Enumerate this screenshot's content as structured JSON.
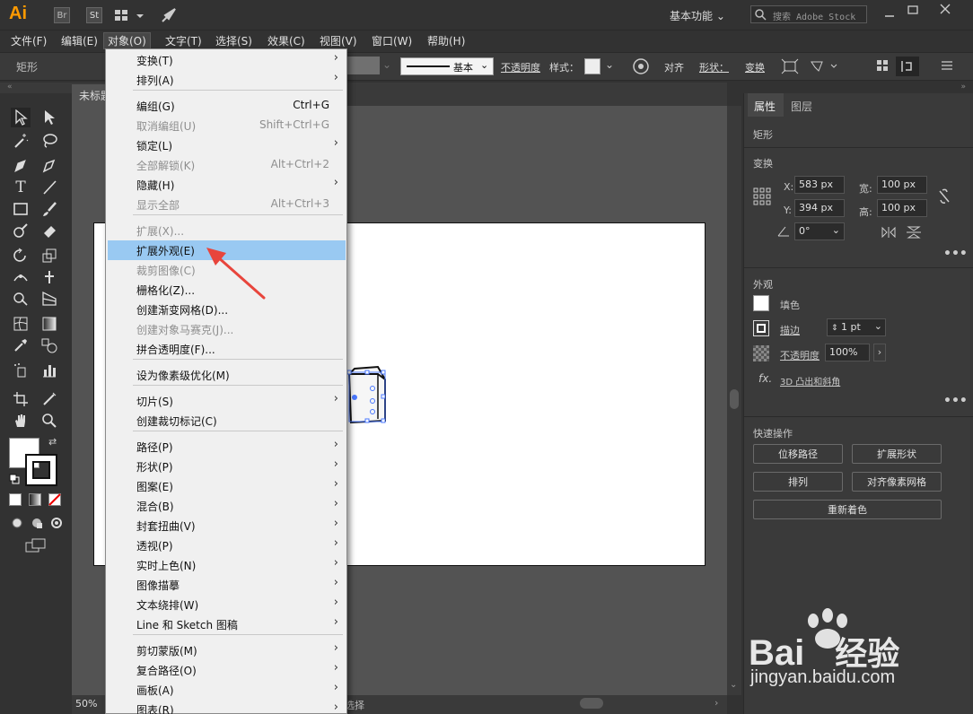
{
  "app": {
    "logo": "Ai",
    "br": "Br",
    "st": "St",
    "workspace": "基本功能",
    "search_placeholder": "搜索 Adobe Stock"
  },
  "menubar": [
    "文件(F)",
    "编辑(E)",
    "对象(O)",
    "文字(T)",
    "选择(S)",
    "效果(C)",
    "视图(V)",
    "窗口(W)",
    "帮助(H)"
  ],
  "control": {
    "shape_label": "矩形",
    "stroke_style": "基本",
    "opacity_label": "不透明度",
    "style_label": "样式：",
    "align": "对齐",
    "shape": "形状：",
    "transform": "变换"
  },
  "document": {
    "tab": "未标题",
    "zoom": "50%",
    "status": "选择"
  },
  "object_menu": {
    "items": [
      {
        "label": "变换(T)",
        "shortcut": "",
        "submenu": true,
        "disabled": false
      },
      {
        "label": "排列(A)",
        "shortcut": "",
        "submenu": true,
        "disabled": false
      },
      {
        "label": "编组(G)",
        "shortcut": "Ctrl+G",
        "submenu": false,
        "disabled": false
      },
      {
        "label": "取消编组(U)",
        "shortcut": "Shift+Ctrl+G",
        "submenu": false,
        "disabled": true
      },
      {
        "label": "锁定(L)",
        "shortcut": "",
        "submenu": true,
        "disabled": false
      },
      {
        "label": "全部解锁(K)",
        "shortcut": "Alt+Ctrl+2",
        "submenu": false,
        "disabled": true
      },
      {
        "label": "隐藏(H)",
        "shortcut": "",
        "submenu": true,
        "disabled": false
      },
      {
        "label": "显示全部",
        "shortcut": "Alt+Ctrl+3",
        "submenu": false,
        "disabled": true
      },
      {
        "label": "扩展(X)...",
        "shortcut": "",
        "submenu": false,
        "disabled": true
      },
      {
        "label": "扩展外观(E)",
        "shortcut": "",
        "submenu": false,
        "disabled": false,
        "highlighted": true
      },
      {
        "label": "裁剪图像(C)",
        "shortcut": "",
        "submenu": false,
        "disabled": true
      },
      {
        "label": "栅格化(Z)...",
        "shortcut": "",
        "submenu": false,
        "disabled": false
      },
      {
        "label": "创建渐变网格(D)...",
        "shortcut": "",
        "submenu": false,
        "disabled": false
      },
      {
        "label": "创建对象马赛克(J)...",
        "shortcut": "",
        "submenu": false,
        "disabled": true
      },
      {
        "label": "拼合透明度(F)...",
        "shortcut": "",
        "submenu": false,
        "disabled": false
      },
      {
        "label": "设为像素级优化(M)",
        "shortcut": "",
        "submenu": false,
        "disabled": false
      },
      {
        "label": "切片(S)",
        "shortcut": "",
        "submenu": true,
        "disabled": false
      },
      {
        "label": "创建裁切标记(C)",
        "shortcut": "",
        "submenu": false,
        "disabled": false
      },
      {
        "label": "路径(P)",
        "shortcut": "",
        "submenu": true,
        "disabled": false
      },
      {
        "label": "形状(P)",
        "shortcut": "",
        "submenu": true,
        "disabled": false
      },
      {
        "label": "图案(E)",
        "shortcut": "",
        "submenu": true,
        "disabled": false
      },
      {
        "label": "混合(B)",
        "shortcut": "",
        "submenu": true,
        "disabled": false
      },
      {
        "label": "封套扭曲(V)",
        "shortcut": "",
        "submenu": true,
        "disabled": false
      },
      {
        "label": "透视(P)",
        "shortcut": "",
        "submenu": true,
        "disabled": false
      },
      {
        "label": "实时上色(N)",
        "shortcut": "",
        "submenu": true,
        "disabled": false
      },
      {
        "label": "图像描摹",
        "shortcut": "",
        "submenu": true,
        "disabled": false
      },
      {
        "label": "文本绕排(W)",
        "shortcut": "",
        "submenu": true,
        "disabled": false
      },
      {
        "label": "Line 和 Sketch 图稿",
        "shortcut": "",
        "submenu": true,
        "disabled": false
      },
      {
        "label": "剪切蒙版(M)",
        "shortcut": "",
        "submenu": true,
        "disabled": false
      },
      {
        "label": "复合路径(O)",
        "shortcut": "",
        "submenu": true,
        "disabled": false
      },
      {
        "label": "画板(A)",
        "shortcut": "",
        "submenu": true,
        "disabled": false
      },
      {
        "label": "图表(R)",
        "shortcut": "",
        "submenu": true,
        "disabled": false
      }
    ]
  },
  "panel": {
    "tabs": [
      "属性",
      "图层"
    ],
    "object_type": "矩形",
    "transform": {
      "title": "变换",
      "x_label": "X:",
      "x": "583 px",
      "y_label": "Y:",
      "y": "394 px",
      "w_label": "宽:",
      "w": "100 px",
      "h_label": "高:",
      "h": "100 px",
      "angle": "0°"
    },
    "appearance": {
      "title": "外观",
      "fill": "填色",
      "stroke": "描边",
      "stroke_value": "1 pt",
      "opacity": "不透明度",
      "opacity_value": "100%",
      "effect": "3D 凸出和斜角",
      "fx": "fx."
    },
    "quick": {
      "title": "快速操作",
      "buttons": [
        "位移路径",
        "扩展形状",
        "排列",
        "对齐像素网格",
        "重新着色"
      ]
    }
  },
  "watermark": {
    "brand": "Bai",
    "brand2": "经验",
    "url": "jingyan.baidu.com"
  },
  "colors": {
    "highlight": "#99c9f2",
    "arrow": "#e8453c",
    "selection": "#4a78ff"
  }
}
